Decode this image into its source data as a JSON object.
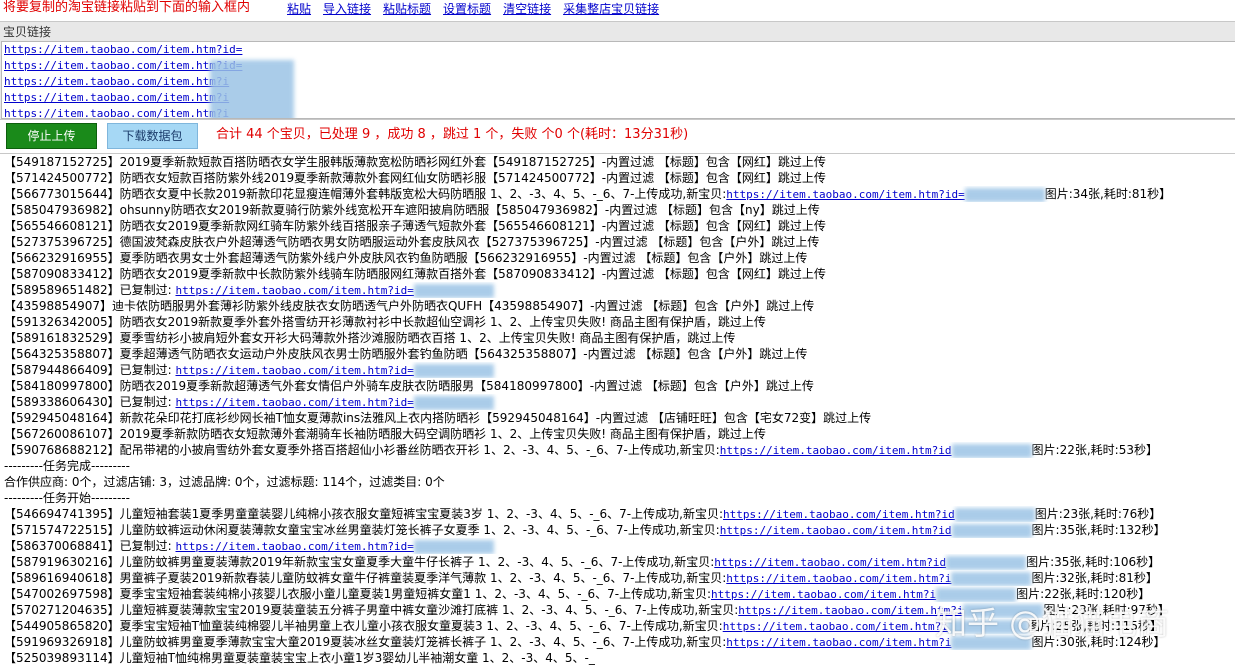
{
  "toolbar": {
    "hint": "将要复制的淘宝链接粘贴到下面的输入框内",
    "links": [
      "粘贴",
      "导入链接",
      "粘贴标题",
      "设置标题",
      "清空链接",
      "采集整店宝贝链接"
    ]
  },
  "link_panel": {
    "label": "宝贝链接",
    "links": [
      "https://item.taobao.com/item.htm?id=",
      "https://item.taobao.com/item.htm?id=",
      "https://item.taobao.com/item.htm?i",
      "https://item.taobao.com/item.htm?i",
      "https://item.taobao.com/item.htm?i"
    ]
  },
  "controls": {
    "stop_label": "停止上传",
    "download_label": "下载数据包",
    "summary": "合计 44 个宝贝，已处理 9 ，成功 8 ，跳过 1 个，失败 个0 个(耗时：13分31秒)"
  },
  "log": [
    {
      "text": "【549187152725】2019夏季新款短款百搭防晒衣女学生服韩版薄款宽松防晒衫网红外套【549187152725】-内置过滤 【标题】包含【网红】跳过上传"
    },
    {
      "text": "【571424500772】防晒衣女短款百搭防紫外线2019夏季新款薄款外套网红仙女防晒衫服【571424500772】-内置过滤 【标题】包含【网红】跳过上传"
    },
    {
      "text": "【566773015644】防晒衣女夏中长款2019新款印花显瘦连帽薄外套韩版宽松大码防晒服 1、2、-3、4、5、-_6、7-上传成功,新宝贝:",
      "url": "https://item.taobao.com/item.htm?id=",
      "tail": "图片:34张,耗时:81秒】"
    },
    {
      "text": "【585047936982】ohsunny防晒衣女2019新款夏骑行防紫外线宽松开车遮阳披肩防晒服【585047936982】-内置过滤 【标题】包含【ny】跳过上传"
    },
    {
      "text": "【565546608121】防晒衣女2019夏季新款网红骑车防紫外线百搭服亲子薄透气短款外套【565546608121】-内置过滤 【标题】包含【网红】跳过上传"
    },
    {
      "text": "【527375396725】德国波梵森皮肤衣户外超薄透气防晒衣男女防晒服运动外套皮肤风衣【527375396725】-内置过滤 【标题】包含【户外】跳过上传"
    },
    {
      "text": "【566232916955】夏季防晒衣男女士外套超薄透气防紫外线户外皮肤风衣钓鱼防晒服【566232916955】-内置过滤 【标题】包含【户外】跳过上传"
    },
    {
      "text": "【587090833412】防晒衣女2019夏季新款中长款防紫外线骑车防晒服网红薄款百搭外套【587090833412】-内置过滤 【标题】包含【网红】跳过上传"
    },
    {
      "text": "【589589651482】已复制过: ",
      "url": "https://item.taobao.com/item.htm?id=",
      "tail": ""
    },
    {
      "text": "【43598854907】迪卡侬防晒服男外套薄衫防紫外线皮肤衣女防晒透气户外防晒衣QUFH【43598854907】-内置过滤 【标题】包含【户外】跳过上传"
    },
    {
      "text": "【591326342005】防晒衣女2019新款夏季外套外搭雪纺开衫薄款衬衫中长款超仙空调衫 1、2、上传宝贝失败! 商品主图有保护盾，跳过上传"
    },
    {
      "text": "【589161832529】夏季雪纺衫小披肩短外套女开衫大码薄款外搭沙滩服防晒衣百搭 1、2、上传宝贝失败! 商品主图有保护盾，跳过上传"
    },
    {
      "text": "【564325358807】夏季超薄透气防晒衣女运动户外皮肤风衣男士防晒服外套钓鱼防晒【564325358807】-内置过滤 【标题】包含【户外】跳过上传"
    },
    {
      "text": "【587944866409】已复制过: ",
      "url": "https://item.taobao.com/item.htm?id=",
      "tail": ""
    },
    {
      "text": "【584180997800】防晒衣2019夏季新款超薄透气外套女情侣户外骑车皮肤衣防晒服男【584180997800】-内置过滤 【标题】包含【户外】跳过上传"
    },
    {
      "text": "【589338606430】已复制过: ",
      "url": "https://item.taobao.com/item.htm?id=",
      "tail": ""
    },
    {
      "text": "【592945048164】新款花朵印花打底衫纱网长袖T恤女夏薄款ins法雅风上衣内搭防晒衫【592945048164】-内置过滤 【店铺旺旺】包含【宅女72变】跳过上传"
    },
    {
      "text": "【567260086107】2019夏季新款防晒衣女短款薄外套潮骑车长袖防晒服大码空调防晒衫 1、2、上传宝贝失败! 商品主图有保护盾，跳过上传"
    },
    {
      "text": "【590768688212】配吊带裙的小披肩雪纺外套女夏季外搭百搭超仙小衫番丝防晒衣开衫 1、2、-3、4、5、-_6、7-上传成功,新宝贝:",
      "url": "https://item.taobao.com/item.htm?id",
      "tail": "图片:22张,耗时:53秒】"
    },
    {
      "text": "---------任务完成---------"
    },
    {
      "text": "合作供应商: 0个，过滤店铺: 3，过滤品牌: 0个，过滤标题: 114个，过滤类目: 0个"
    },
    {
      "text": "---------任务开始---------"
    },
    {
      "text": "【546694741395】儿童短袖套装1夏季男童童装婴儿纯棉小孩衣服女童短裤宝宝夏装3岁 1、2、-3、4、5、-_6、7-上传成功,新宝贝:",
      "url": "https://item.taobao.com/item.htm?id",
      "tail": "图片:23张,耗时:76秒】"
    },
    {
      "text": "【571574722515】儿童防蚊裤运动休闲夏装薄款女童宝宝冰丝男童装灯笼长裤子女夏季 1、2、-3、4、5、-_6、7-上传成功,新宝贝:",
      "url": "https://item.taobao.com/item.htm?id",
      "tail": "图片:35张,耗时:132秒】"
    },
    {
      "text": "【586370068841】已复制过: ",
      "url": "https://item.taobao.com/item.htm?id=",
      "tail": ""
    },
    {
      "text": "【587919630216】儿童防蚊裤男童夏装薄款2019年新款宝宝女童夏季大童牛仔长裤子 1、2、-3、4、5、-_6、7-上传成功,新宝贝:",
      "url": "https://item.taobao.com/item.htm?id",
      "tail": "图片:35张,耗时:106秒】"
    },
    {
      "text": "【589616940618】男童裤子夏装2019新款春装儿童防蚊裤女童牛仔裤童装夏季洋气薄款 1、2、-3、4、5、-_6、7-上传成功,新宝贝:",
      "url": "https://item.taobao.com/item.htm?i",
      "tail": "图片:32张,耗时:81秒】"
    },
    {
      "text": "【547002697598】夏季宝宝短袖套装纯棉小孩婴儿衣服小童儿童夏装1男童短裤女童1 1、2、-3、4、5、-_6、7-上传成功,新宝贝:",
      "url": "https://item.taobao.com/item.htm?i",
      "tail": "图片:22张,耗时:120秒】"
    },
    {
      "text": "【570271204635】儿童短裤夏装薄款宝宝2019夏装童装五分裤子男童中裤女童沙滩打底裤 1、2、-3、4、5、-_6、7-上传成功,新宝贝:",
      "url": "https://item.taobao.com/item.htm?i",
      "tail": "图片:23张,耗时:97秒】"
    },
    {
      "text": "【544905865820】夏季宝宝短袖T恤童装纯棉婴儿半袖男童上衣儿童小孩衣服女童夏装3 1、2、-3、4、5、-_6、7-上传成功,新宝贝:",
      "url": "https://item.taobao.com/item.htm?i",
      "tail": "图片:25张,耗时:115秒】"
    },
    {
      "text": "【591969326918】儿童防蚊裤男童夏季薄款宝宝大童2019夏装冰丝女童装灯笼裤长裤子 1、2、-3、4、5、-_6、7-上传成功,新宝贝:",
      "url": "https://item.taobao.com/item.htm?i",
      "tail": "图片:30张,耗时:124秒】"
    },
    {
      "text": "【525039893114】儿童短袖T恤纯棉男童夏装童装宝宝上衣小童1岁3婴幼儿半袖潮女童 1、2、-3、4、5、-_"
    }
  ],
  "watermark": "知乎 @猫猫电商"
}
